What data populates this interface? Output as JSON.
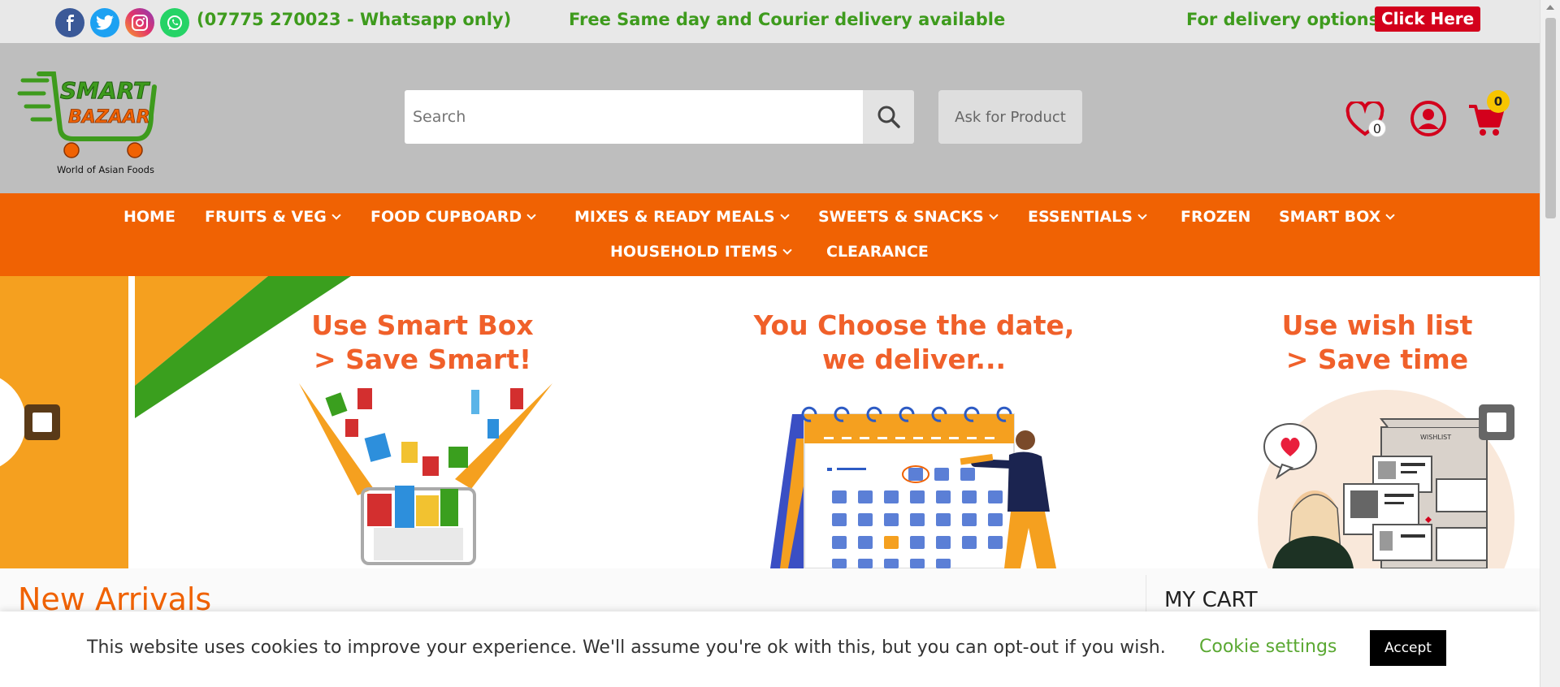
{
  "topbar": {
    "phone": "(07775 270023 - Whatsapp only)",
    "promo": "Free Same day and Courier delivery available",
    "delivery_label": "For delivery options",
    "click_here": "Click Here",
    "social_icons": [
      "facebook-icon",
      "twitter-icon",
      "instagram-icon",
      "whatsapp-icon"
    ]
  },
  "header": {
    "logo_line1": "SMART",
    "logo_line2": "BAZAAR",
    "logo_tagline": "World of Asian Foods",
    "search_placeholder": "Search",
    "ask_label": "Ask for Product",
    "wishlist_count": "0",
    "cart_count": "0"
  },
  "nav": {
    "items": [
      {
        "label": "HOME"
      },
      {
        "label": "FRUITS & VEG"
      },
      {
        "label": "FOOD CUPBOARD"
      },
      {
        "label": "MIXES & READY MEALS"
      },
      {
        "label": "SWEETS & SNACKS"
      },
      {
        "label": "ESSENTIALS"
      },
      {
        "label": "FROZEN"
      },
      {
        "label": "SMART BOX"
      },
      {
        "label": "HOUSEHOLD ITEMS"
      },
      {
        "label": "CLEARANCE"
      }
    ]
  },
  "banner": {
    "slide1_line1": "Use Smart Box",
    "slide1_line2": "> Save Smart!",
    "slide2_line1": "You Choose the date,",
    "slide2_line2": "we deliver...",
    "slide3_line1": "Use wish list",
    "slide3_line2": "> Save time",
    "wishlist_tag": "WISHLIST"
  },
  "content": {
    "new_arrivals": "New Arrivals",
    "my_cart": "MY CART"
  },
  "cookie": {
    "text": "This website uses cookies to improve your experience. We'll assume you're ok with this, but you can opt-out if you wish.",
    "settings_label": "Cookie settings",
    "accept_label": "Accept"
  },
  "colors": {
    "brand_orange": "#f06203",
    "brand_green": "#3e9b1d",
    "header_gray": "#bebebe",
    "alert_red": "#d3001c"
  }
}
